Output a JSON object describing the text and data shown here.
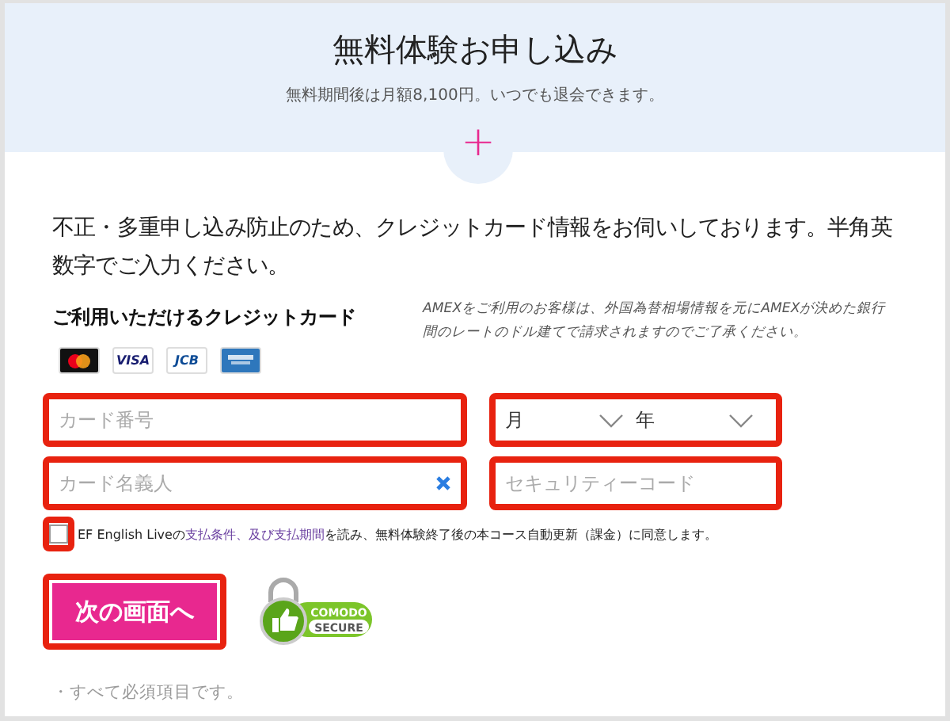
{
  "header": {
    "title": "無料体験お申し込み",
    "subtitle": "無料期間後は月額8,100円。いつでも退会できます。",
    "toggle_icon": "+"
  },
  "intro": "不正・多重申し込み防止のため、クレジットカード情報をお伺いしております。半角英数字でご入力ください。",
  "cards": {
    "heading": "ご利用いただけるクレジットカード",
    "note": "AMEXをご利用のお客様は、外国為替相場情報を元にAMEXが決めた銀行間のレートのドル建てで請求されますのでご了承ください。",
    "logos": [
      {
        "kind": "mastercard"
      },
      {
        "kind": "visa",
        "label": "VISA"
      },
      {
        "kind": "jcb",
        "label": "JCB"
      },
      {
        "kind": "amex"
      }
    ]
  },
  "fields": [
    {
      "kind": "text",
      "placeholder": "カード番号",
      "highlighted": true
    },
    {
      "kind": "expiry",
      "month": "月",
      "year": "年",
      "highlighted": true
    },
    {
      "kind": "text",
      "placeholder": "カード名義人",
      "clearable": true,
      "highlighted": true
    },
    {
      "kind": "text",
      "placeholder": "セキュリティーコード",
      "highlighted": true
    }
  ],
  "consent": {
    "checked": false,
    "highlighted": true,
    "before": "EF English Liveの",
    "link": "支払条件、及び支払期間",
    "after": "を読み、無料体験終了後の本コース自動更新（課金）に同意します。"
  },
  "submit": {
    "label": "次の画面へ",
    "highlighted": true
  },
  "seal": {
    "top": "COMODO",
    "bottom": "SECURE"
  },
  "footnote": "・すべて必須項目です。"
}
